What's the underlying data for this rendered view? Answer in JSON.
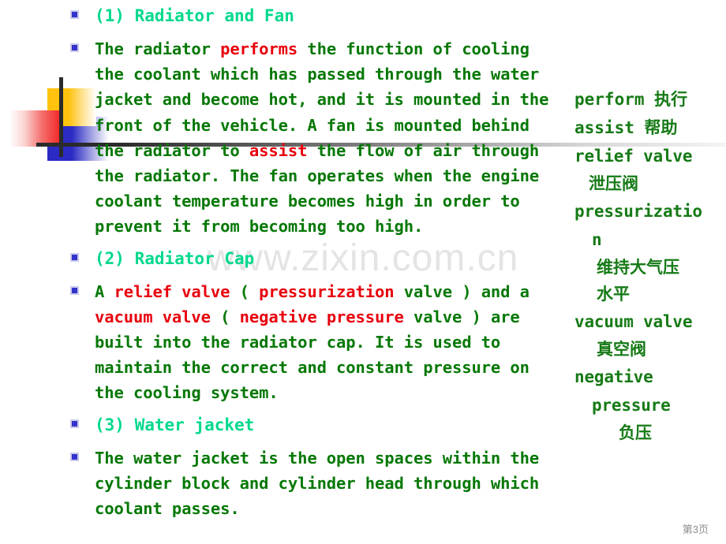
{
  "slide": {
    "page_footer": "第3页",
    "watermark": "www.zixin.com.cn",
    "colors": {
      "heading_green": "#00d98b",
      "body_green": "#067806",
      "highlight_red": "#e8000d",
      "glossary_green": "#167a16",
      "bullet_blue": "#3333cc",
      "deco_yellow": "#ffc20e",
      "deco_blue": "#2b2bc4",
      "deco_red": "#f21c1c",
      "watermark_gray": "#e4e4e4",
      "footer_gray": "#8d8d8d"
    }
  },
  "content": {
    "section1_heading": "(1) Radiator and Fan",
    "section1_body": {
      "s1": "The radiator ",
      "s2": "performs",
      "s3": " the function of cooling the coolant which has passed through the water jacket and become hot, and it is mounted in the front of the vehicle. A fan is mounted behind the radiator to ",
      "s4": "assist",
      "s5": " the flow of air through the radiator. The fan operates when the engine coolant temperature becomes high in order to prevent it from becoming too high."
    },
    "section2_heading": "(2) Radiator Cap",
    "section2_body": {
      "s1": "A ",
      "s2": "relief valve",
      "s3": " ( ",
      "s4": "pressurization",
      "s5": " valve ) and a ",
      "s6": "vacuum valve",
      "s7": " ( ",
      "s8": "negative pressure",
      "s9": " valve ) are built into the radiator cap. It is used to maintain the correct and constant pressure on the cooling system."
    },
    "section3_heading": "(3) Water jacket",
    "section3_body": "The water jacket is the open spaces within the cylinder block and cylinder head through which coolant passes."
  },
  "glossary": {
    "entries": [
      {
        "id": "perform",
        "line1": "perform 执行"
      },
      {
        "id": "assist",
        "line1": "assist 帮助"
      },
      {
        "id": "relief-valve",
        "line1": "relief valve",
        "line2": "泄压阀"
      },
      {
        "id": "pressurization",
        "line1": "pressurizatio",
        "line2": "n",
        "line3": "维持大气压",
        "line4": "水平"
      },
      {
        "id": "vacuum-valve",
        "line1": "vacuum valve",
        "line2": "真空阀"
      },
      {
        "id": "negative-pressure",
        "line1": "negative",
        "line2": "pressure",
        "line3": "负压"
      }
    ]
  }
}
